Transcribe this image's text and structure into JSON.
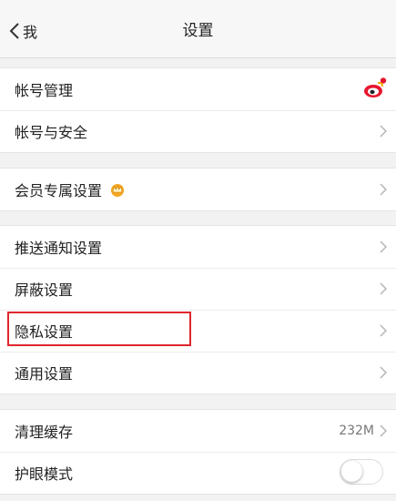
{
  "nav": {
    "back_label": "我",
    "title": "设置"
  },
  "groups": [
    {
      "rows": [
        {
          "label": "帐号管理",
          "icon": "weibo-icon"
        },
        {
          "label": "帐号与安全"
        }
      ]
    },
    {
      "rows": [
        {
          "label": "会员专属设置",
          "icon": "crown-icon"
        }
      ]
    },
    {
      "rows": [
        {
          "label": "推送通知设置"
        },
        {
          "label": "屏蔽设置"
        },
        {
          "label": "隐私设置",
          "highlighted": true
        },
        {
          "label": "通用设置"
        }
      ]
    },
    {
      "rows": [
        {
          "label": "清理缓存",
          "value": "232M"
        },
        {
          "label": "护眼模式",
          "toggle": "off"
        }
      ]
    }
  ],
  "colors": {
    "highlight": "#e0262d",
    "weibo_red": "#e6162d",
    "weibo_yellow": "#f2a900",
    "crown": "#f5a623"
  }
}
